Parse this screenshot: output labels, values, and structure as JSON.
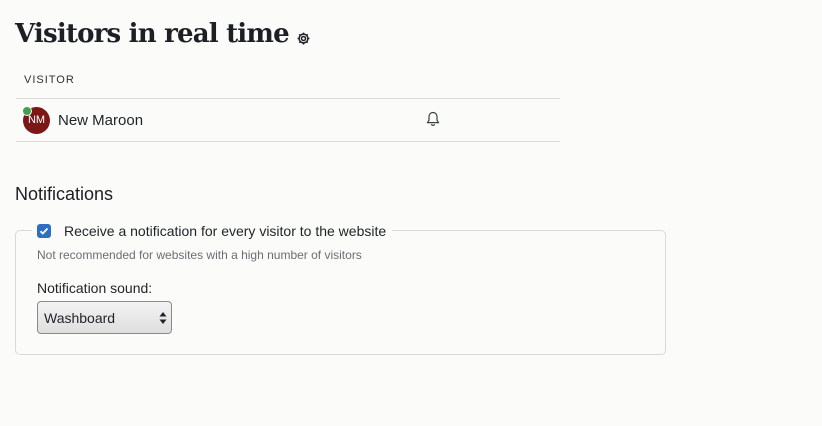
{
  "header": {
    "title": "Visitors in real time",
    "settings_icon": "gear-icon"
  },
  "visitors": {
    "column_header": "VISITOR",
    "rows": [
      {
        "initials": "NM",
        "name": "New Maroon",
        "avatar_color": "#7b1717",
        "status": "online",
        "status_color": "#3fa14a",
        "action_icon": "bell-icon"
      }
    ]
  },
  "notifications": {
    "title": "Notifications",
    "every_visitor_label": "Receive a notification for every visitor to the website",
    "every_visitor_checked": true,
    "helper_text": "Not recommended for websites with a high number of visitors",
    "sound_label": "Notification sound:",
    "sound_value": "Washboard"
  },
  "colors": {
    "accent": "#2f6dc4",
    "background": "#fbfbf9"
  }
}
